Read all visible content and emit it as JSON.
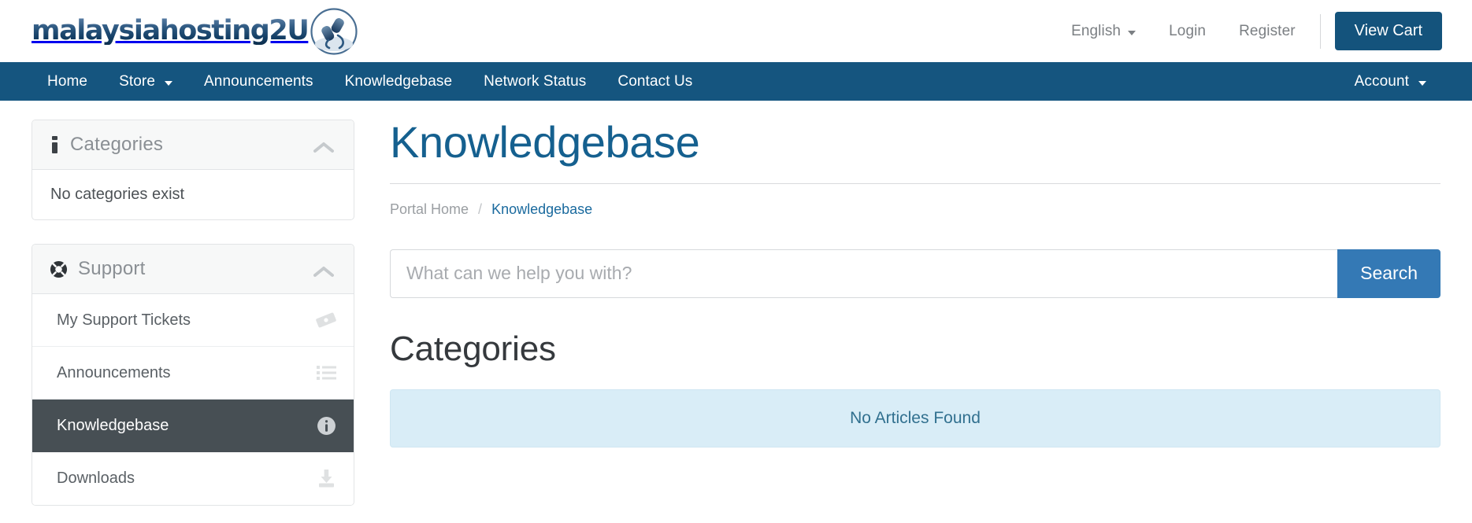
{
  "header": {
    "logo_text": "malaysiahosting2U",
    "logo_icon": "plug-connector-circle-logo",
    "language": {
      "label": "English",
      "icon": "chevron-down-icon"
    },
    "login_label": "Login",
    "register_label": "Register",
    "cart_label": "View Cart"
  },
  "mainnav": {
    "items": [
      {
        "label": "Home",
        "icon": null
      },
      {
        "label": "Store",
        "icon": "chevron-down-icon"
      },
      {
        "label": "Announcements",
        "icon": null
      },
      {
        "label": "Knowledgebase",
        "icon": null
      },
      {
        "label": "Network Status",
        "icon": null
      },
      {
        "label": "Contact Us",
        "icon": null
      }
    ],
    "account": {
      "label": "Account",
      "icon": "chevron-down-icon"
    }
  },
  "sidebar": {
    "categories_panel": {
      "title": "Categories",
      "icon": "info-bold-icon",
      "collapse_icon": "chevron-up-icon",
      "empty_text": "No categories exist"
    },
    "support_panel": {
      "title": "Support",
      "icon": "lifebuoy-icon",
      "collapse_icon": "chevron-up-icon",
      "items": [
        {
          "label": "My Support Tickets",
          "icon": "ticket-icon",
          "active": false
        },
        {
          "label": "Announcements",
          "icon": "list-icon",
          "active": false
        },
        {
          "label": "Knowledgebase",
          "icon": "info-circle-icon",
          "active": true
        },
        {
          "label": "Downloads",
          "icon": "download-icon",
          "active": false
        }
      ]
    }
  },
  "main": {
    "page_title": "Knowledgebase",
    "breadcrumb": {
      "home": "Portal Home",
      "separator": "/",
      "current": "Knowledgebase"
    },
    "search": {
      "placeholder": "What can we help you with?",
      "value": "",
      "button_label": "Search"
    },
    "categories_heading": "Categories",
    "empty_alert": "No Articles Found"
  },
  "colors": {
    "navbar": "#15557f",
    "cart_button": "#14537c",
    "search_button": "#3479b5",
    "title_blue": "#15608f",
    "active_item": "#474f54",
    "alert_bg": "#d9edf7",
    "alert_text": "#31708f"
  }
}
